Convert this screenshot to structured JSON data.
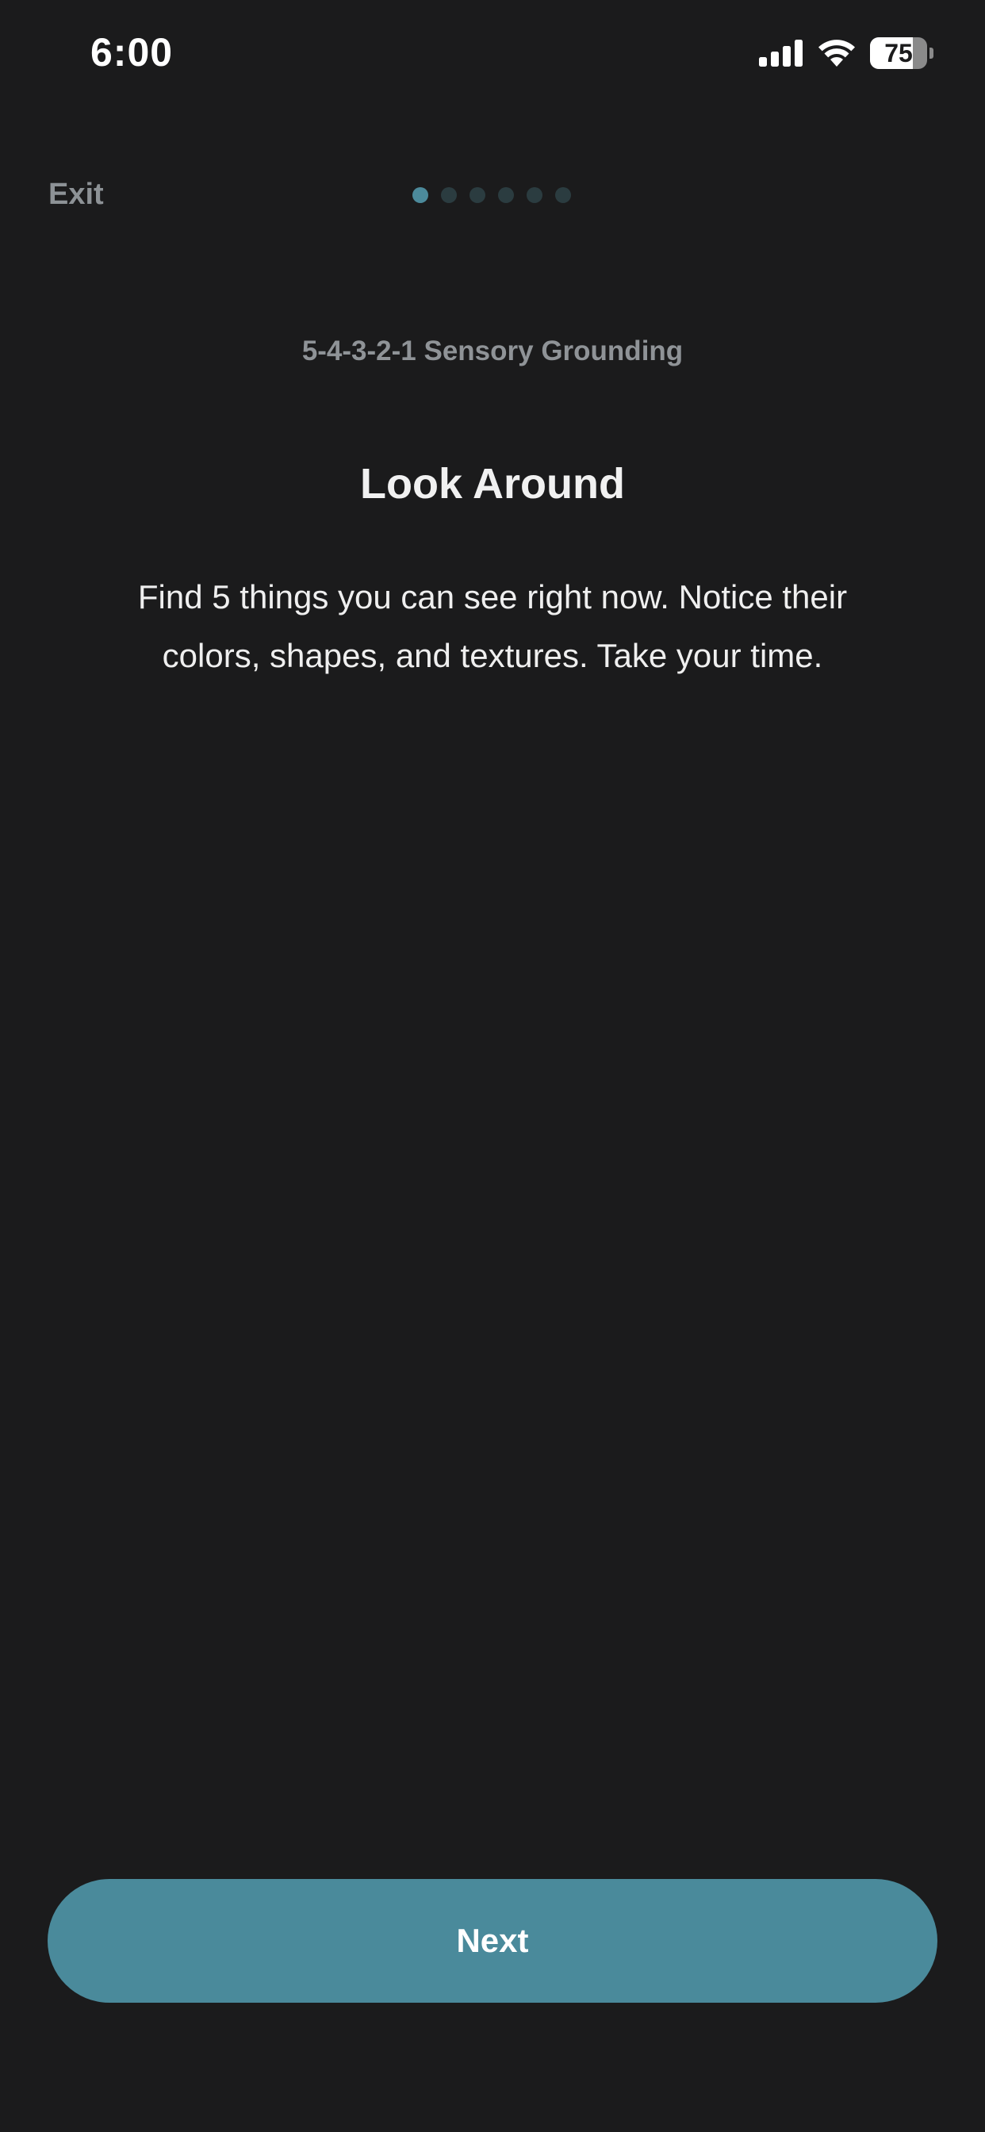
{
  "status_bar": {
    "time": "6:00",
    "battery_level": "75",
    "battery_percent": 75,
    "signal_icon": "cellular-signal-icon",
    "wifi_icon": "wifi-icon",
    "battery_icon": "battery-icon"
  },
  "nav": {
    "exit_label": "Exit",
    "progress": {
      "total_steps": 6,
      "current_step": 1
    }
  },
  "content": {
    "exercise_name": "5-4-3-2-1 Sensory Grounding",
    "step_title": "Look Around",
    "instruction": "Find 5 things you can see right now. Notice their colors, shapes, and textures. Take your time."
  },
  "footer": {
    "next_label": "Next"
  },
  "colors": {
    "background": "#1b1b1c",
    "accent": "#4a8a9b",
    "dot_inactive": "#2b3c40",
    "muted_text": "#8f9397"
  }
}
